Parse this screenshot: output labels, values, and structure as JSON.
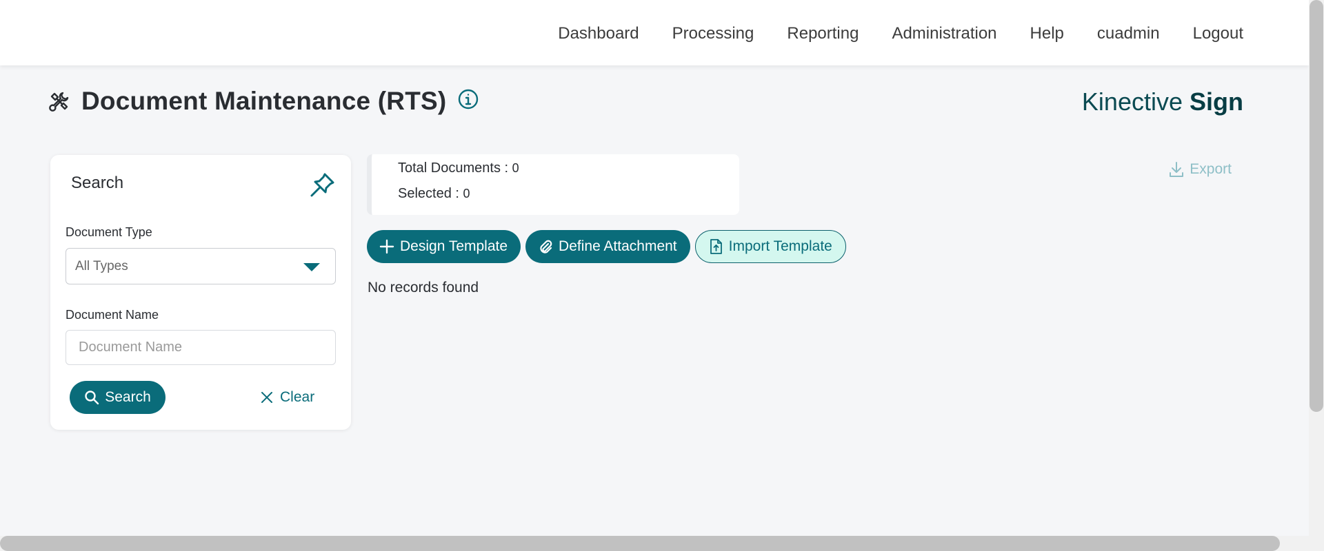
{
  "nav": {
    "items": [
      "Dashboard",
      "Processing",
      "Reporting",
      "Administration",
      "Help",
      "cuadmin",
      "Logout"
    ]
  },
  "page": {
    "title": "Document Maintenance (RTS)",
    "title_icon": "tools-icon",
    "info_icon": "info-icon"
  },
  "brand": {
    "name_light": "Kinective",
    "name_bold": "Sign"
  },
  "search_panel": {
    "title": "Search",
    "pin_icon": "pin-icon",
    "document_type_label": "Document Type",
    "document_type_value": "All Types",
    "document_name_label": "Document Name",
    "document_name_placeholder": "Document Name",
    "document_name_value": "",
    "search_button": "Search",
    "clear_button": "Clear"
  },
  "summary": {
    "total_label": "Total Documents : ",
    "total_value": "0",
    "selected_label": "Selected : ",
    "selected_value": "0"
  },
  "export": {
    "label": "Export",
    "icon": "download-icon"
  },
  "actions": {
    "design_template": "Design Template",
    "define_attachment": "Define Attachment",
    "import_template": "Import Template"
  },
  "results": {
    "empty_message": "No records found"
  },
  "colors": {
    "accent": "#0a6c7a",
    "import_bg": "#d4f7ef",
    "page_bg": "#f5f6f8"
  }
}
